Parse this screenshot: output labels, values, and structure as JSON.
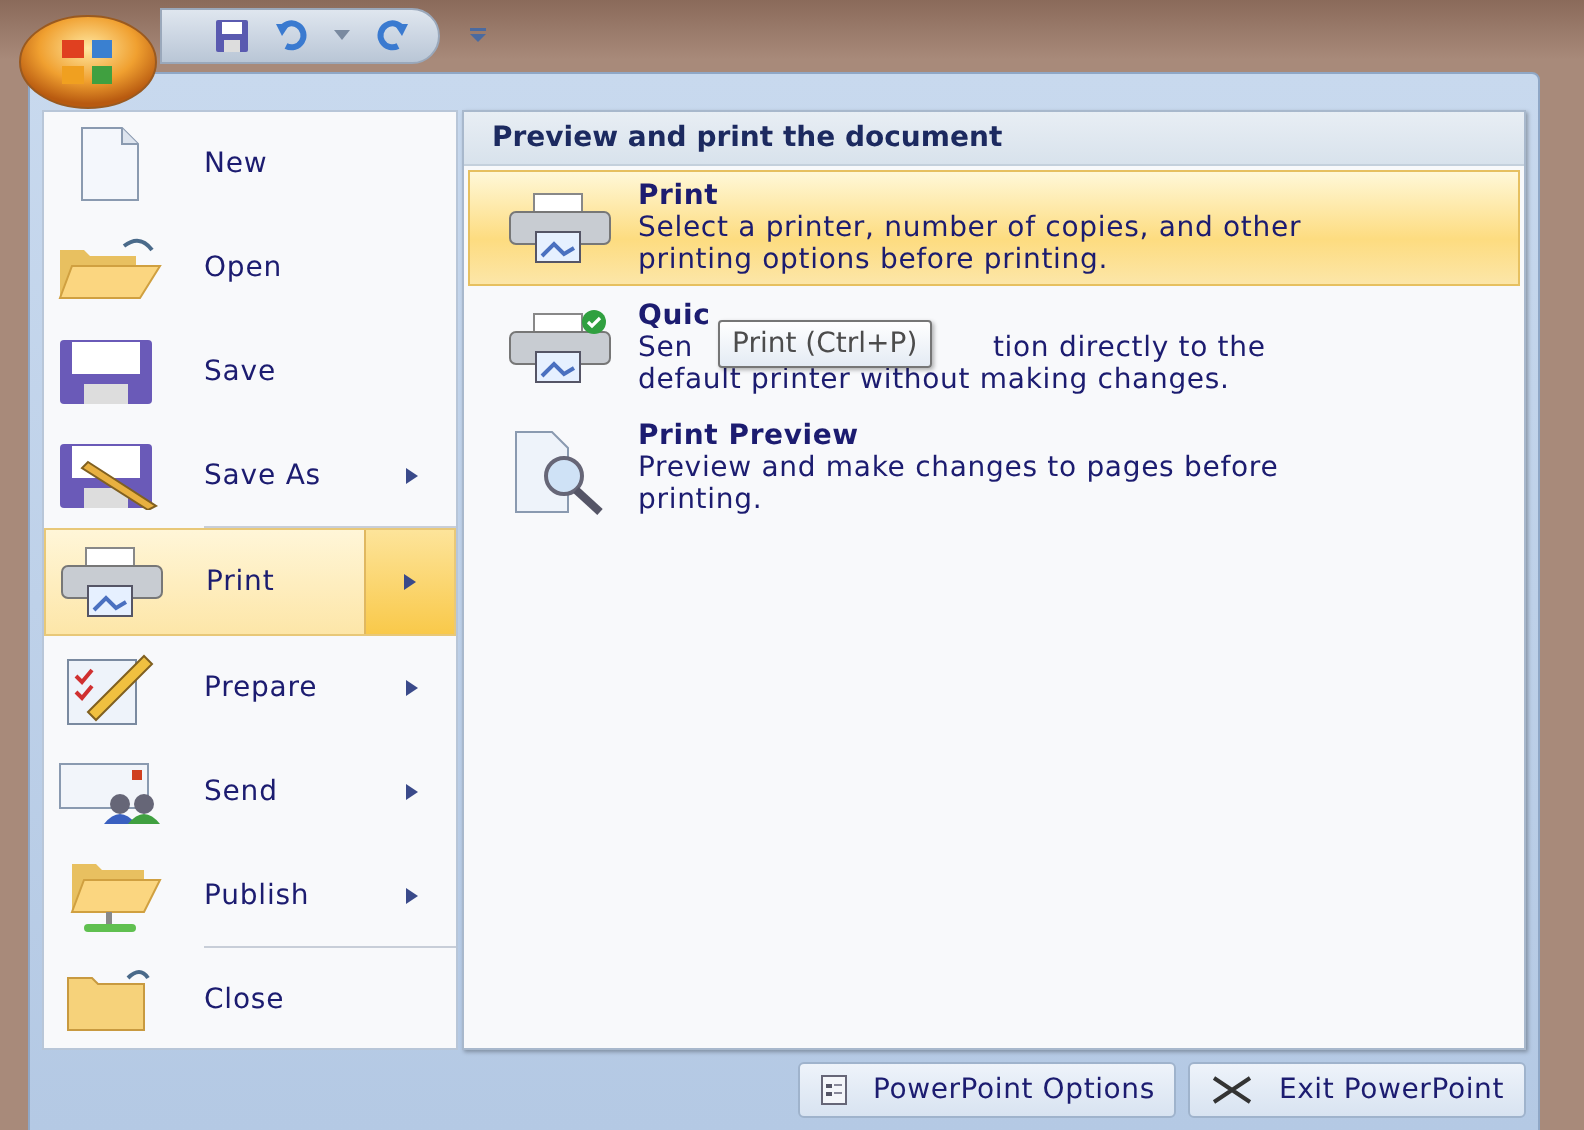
{
  "menu": {
    "items": [
      {
        "label": "New",
        "has_submenu": false,
        "selected": false,
        "separator_after": false
      },
      {
        "label": "Open",
        "has_submenu": false,
        "selected": false,
        "separator_after": false
      },
      {
        "label": "Save",
        "has_submenu": false,
        "selected": false,
        "separator_after": false
      },
      {
        "label": "Save As",
        "has_submenu": true,
        "selected": false,
        "separator_after": true
      },
      {
        "label": "Print",
        "has_submenu": true,
        "selected": true,
        "separator_after": false
      },
      {
        "label": "Prepare",
        "has_submenu": true,
        "selected": false,
        "separator_after": false
      },
      {
        "label": "Send",
        "has_submenu": true,
        "selected": false,
        "separator_after": false
      },
      {
        "label": "Publish",
        "has_submenu": true,
        "selected": false,
        "separator_after": true
      },
      {
        "label": "Close",
        "has_submenu": false,
        "selected": false,
        "separator_after": false
      }
    ]
  },
  "submenu": {
    "heading": "Preview and print the document",
    "items": [
      {
        "kind": "full",
        "title": "Print",
        "description": "Select a printer, number of copies, and other printing options before printing.",
        "selected": true
      },
      {
        "kind": "covered",
        "title": "Quic",
        "line_parts": [
          "Sen",
          "tion directly to the"
        ],
        "description": "default printer without making changes.",
        "selected": false
      },
      {
        "kind": "full",
        "title": "Print Preview",
        "description": "Preview and make changes to pages before printing.",
        "selected": false
      }
    ]
  },
  "tooltip": {
    "text": "Print (Ctrl+P)"
  },
  "footer_buttons": [
    "PowerPoint Options",
    "Exit PowerPoint"
  ]
}
